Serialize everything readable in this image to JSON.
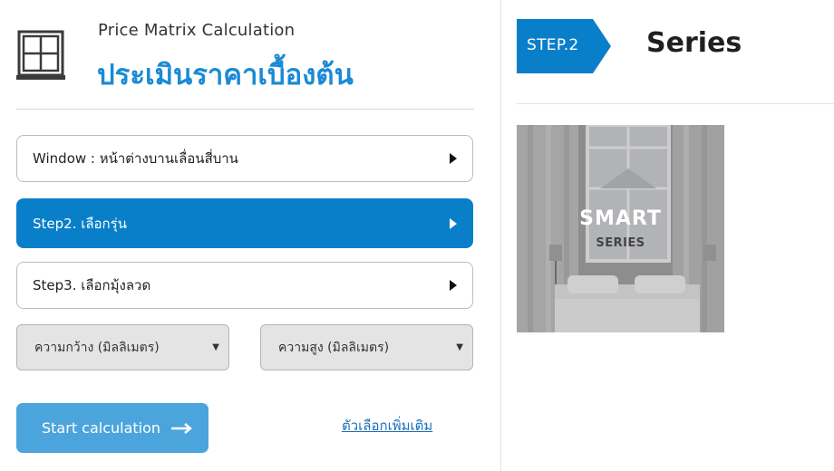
{
  "header": {
    "subtitle": "Price Matrix Calculation",
    "title": "ประเมินราคาเบื้องต้น",
    "icon": "window-icon"
  },
  "steps": [
    {
      "label": "Window : หน้าต่างบานเลื่อนสี่บาน",
      "active": false
    },
    {
      "label": "Step2. เลือกรุ่น",
      "active": true
    },
    {
      "label": "Step3. เลือกมุ้งลวด",
      "active": false
    }
  ],
  "dimensions": {
    "width_label": "ความกว้าง (มิลลิเมตร)",
    "height_label": "ความสูง (มิลลิเมตร)"
  },
  "actions": {
    "start_label": "Start calculation",
    "more_options_label": "ตัวเลือกเพิ่มเติม"
  },
  "right_panel": {
    "step_tag": "STEP.2",
    "heading": "Series",
    "card": {
      "title": "SMART",
      "subtitle": "SERIES"
    }
  },
  "colors": {
    "accent": "#0a7fc9",
    "title_blue": "#1a8ad6",
    "button_blue": "#4ba5dc",
    "link": "#1b6fb8"
  }
}
